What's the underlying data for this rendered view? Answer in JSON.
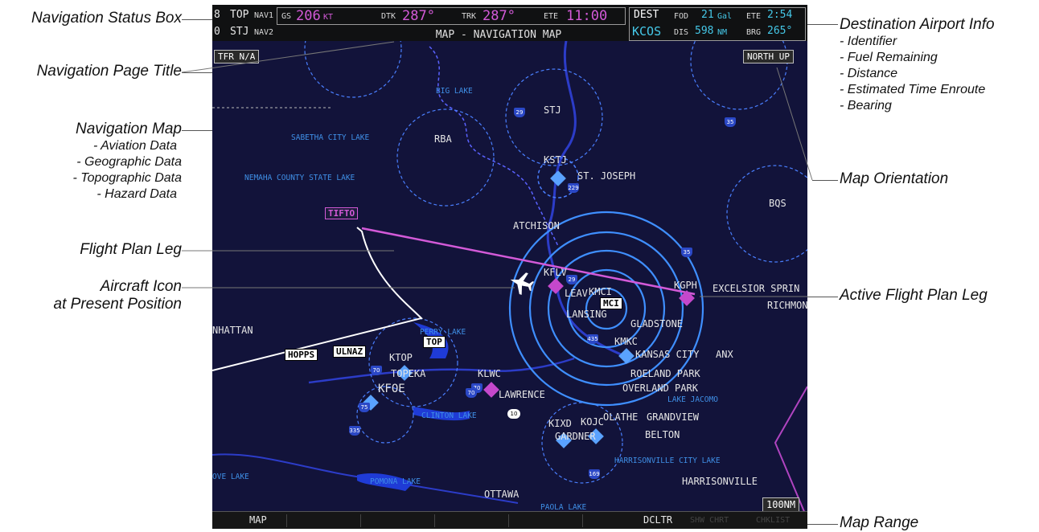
{
  "callouts": {
    "nav_status_box": "Navigation Status Box",
    "nav_page_title": "Navigation Page Title",
    "nav_map": {
      "title": "Navigation Map",
      "items": [
        "- Aviation Data",
        "- Geographic Data",
        "- Topographic Data",
        "- Hazard Data"
      ]
    },
    "flight_plan_leg": "Flight Plan Leg",
    "aircraft_icon": [
      "Aircraft Icon",
      "at Present Position"
    ],
    "dest_info": {
      "title": "Destination Airport Info",
      "items": [
        "- Identifier",
        "- Fuel Remaining",
        "- Distance",
        "- Estimated Time Enroute",
        "- Bearing"
      ]
    },
    "map_orientation": "Map Orientation",
    "active_leg": "Active Flight Plan Leg",
    "map_range": "Map Range"
  },
  "status": {
    "nav1_id": "TOP",
    "nav1_label": "NAV1",
    "nav2_id": "STJ",
    "nav2_label": "NAV2",
    "gs_label": "GS",
    "gs_value": "206",
    "gs_unit": "KT",
    "dtk_label": "DTK",
    "dtk_value": "287°",
    "trk_label": "TRK",
    "trk_value": "287°",
    "ete_label": "ETE",
    "ete_value": "11:00",
    "title": "MAP - NAVIGATION MAP",
    "dest_label": "DEST",
    "dest_id": "KCOS",
    "fod_label": "FOD",
    "fod_value": "21",
    "fod_unit": "Gal",
    "dis_label": "DIS",
    "dis_value": "598",
    "dis_unit": "NM",
    "ete2_label": "ETE",
    "ete2_value": "2:54",
    "brg_label": "BRG",
    "brg_value": "265°"
  },
  "map": {
    "tfr": "TFR N/A",
    "orientation": "NORTH UP",
    "range": "100NM",
    "labels": {
      "stj": "STJ",
      "rba": "RBA",
      "kstj": "KSTJ",
      "st_joseph": "ST. JOSEPH",
      "bqs": "BQS",
      "atchison": "ATCHISON",
      "kflv": "KFLV",
      "kmci": "KMCI",
      "leavenworth": "LEAV",
      "lansing": "LANSING",
      "kgph": "KGPH",
      "excelsior": "EXCELSIOR SPRIN",
      "richmond": "RICHMON",
      "gladstone": "GLADSTONE",
      "kmkc": "KMKC",
      "kansas_city": "KANSAS CITY",
      "anx": "ANX",
      "ktop": "KTOP",
      "topeka": "TOPEKA",
      "kfoe": "KFOE",
      "klwc": "KLWC",
      "lawrence": "LAWRENCE",
      "roeland": "ROELAND PARK",
      "overland": "OVERLAND PARK",
      "kixd": "KIXD",
      "kojc": "KOJC",
      "olathe": "OLATHE",
      "gardner": "GARDNER",
      "grandview": "GRANDVIEW",
      "belton": "BELTON",
      "harrisonville": "HARRISONVILLE",
      "ottawa": "OTTAWA",
      "manhattan": "NHATTAN"
    },
    "water": {
      "big_lake": "BIG LAKE",
      "sabetha": "SABETHA CITY LAKE",
      "nemaha": "NEMAHA COUNTY STATE LAKE",
      "perry": "PERRY LAKE",
      "clinton": "CLINTON LAKE",
      "pomona": "POMONA LAKE",
      "paola": "PAOLA LAKE",
      "jacomo": "LAKE JACOMO",
      "harrisonville_lake": "HARRISONVILLE CITY LAKE",
      "ove": "OVE LAKE"
    },
    "waypoints": {
      "tifto": "TIFTO",
      "hopps": "HOPPS",
      "ulnaz": "ULNAZ",
      "top": "TOP",
      "mci": "MCI"
    }
  },
  "softkeys": {
    "map": "MAP",
    "dcltr": "DCLTR",
    "shw_chrt": "SHW CHRT",
    "chkl": "CHKLIST"
  },
  "colors": {
    "magenta": "#d35ad8",
    "cyan": "#45c8e8",
    "range_ring": "#3f8fff",
    "background": "#12133a"
  }
}
